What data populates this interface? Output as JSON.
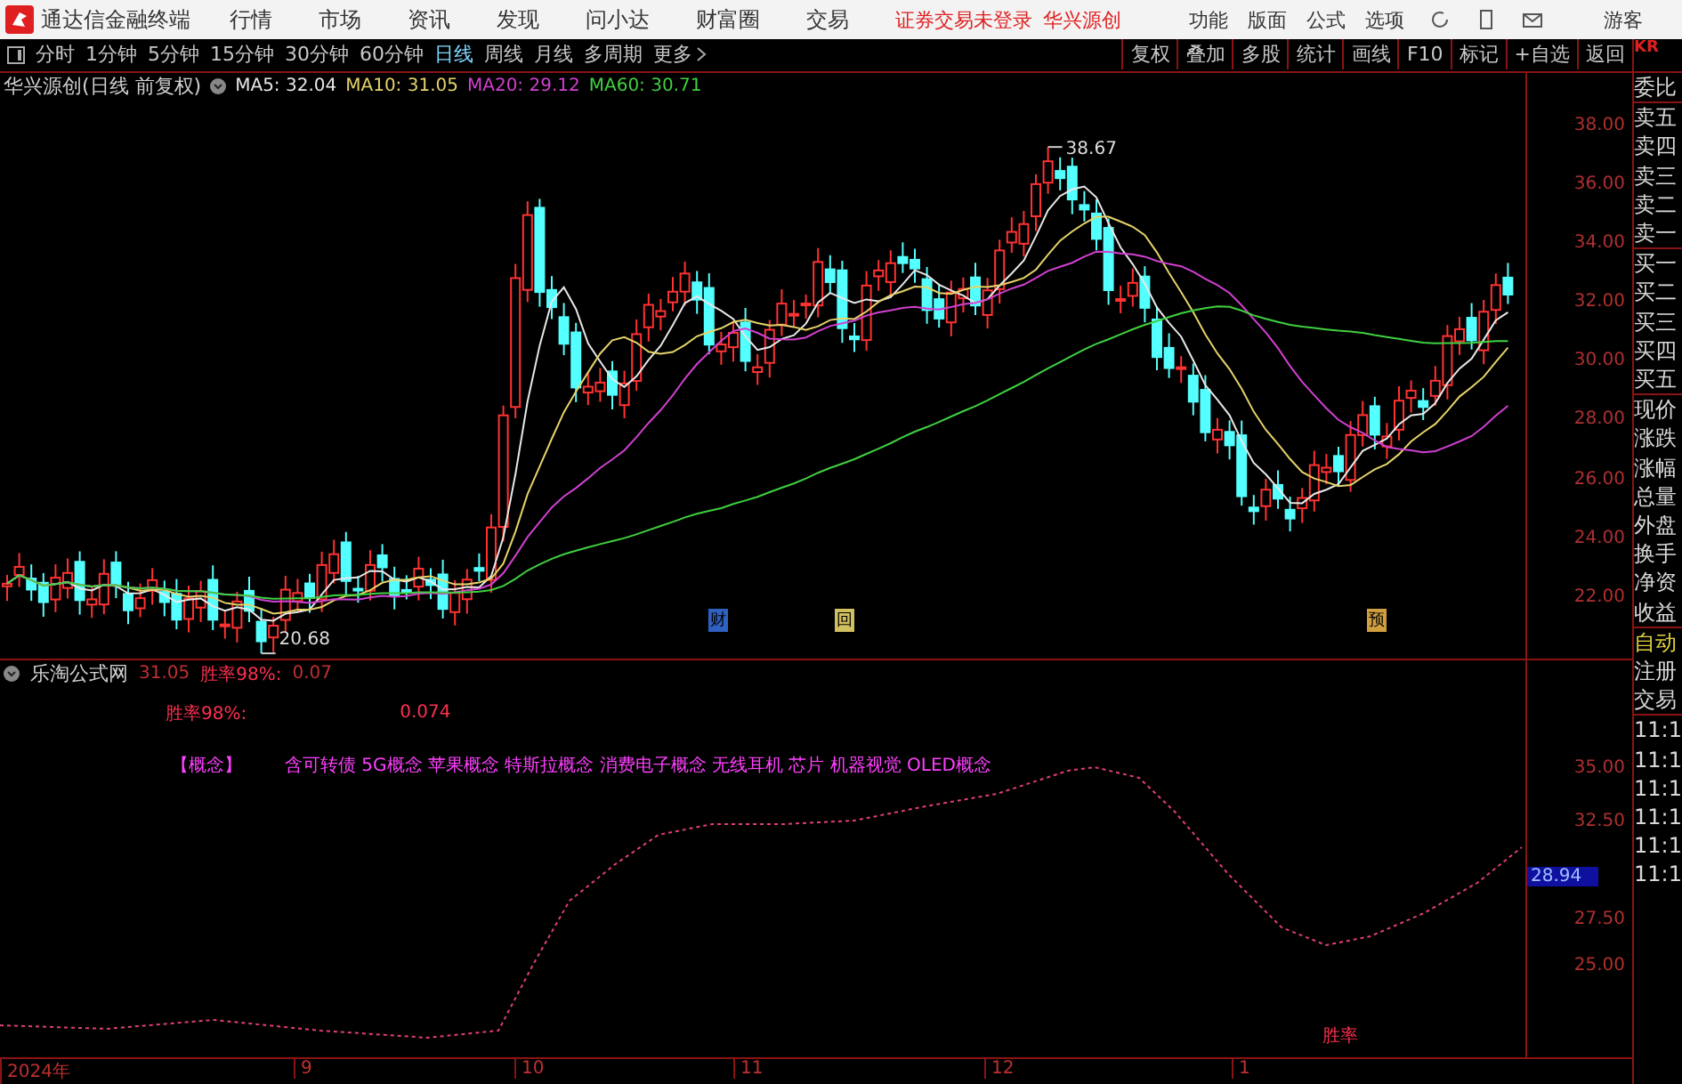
{
  "menubar": {
    "app_title": "通达信金融终端",
    "menus": [
      "行情",
      "市场",
      "资讯",
      "发现",
      "问小达",
      "财富圈",
      "交易"
    ],
    "login_status": "证券交易未登录",
    "stock": "华兴源创",
    "tools": [
      "功能",
      "版面",
      "公式",
      "选项"
    ],
    "user": "游客"
  },
  "toolbar": {
    "periods": [
      {
        "label": "分时",
        "selected": false
      },
      {
        "label": "1分钟",
        "selected": false
      },
      {
        "label": "5分钟",
        "selected": false
      },
      {
        "label": "15分钟",
        "selected": false
      },
      {
        "label": "30分钟",
        "selected": false
      },
      {
        "label": "60分钟",
        "selected": false
      },
      {
        "label": "日线",
        "selected": true
      },
      {
        "label": "周线",
        "selected": false
      },
      {
        "label": "月线",
        "selected": false
      },
      {
        "label": "多周期",
        "selected": false
      },
      {
        "label": "更多",
        "selected": false
      }
    ],
    "actions": [
      "复权",
      "叠加",
      "多股",
      "统计",
      "画线",
      "F10",
      "标记",
      "+自选",
      "返回"
    ]
  },
  "chart": {
    "title": "华兴源创(日线 前复权)",
    "ma": [
      {
        "label": "MA5: 32.04",
        "color": "#e8e8e8"
      },
      {
        "label": "MA10: 31.05",
        "color": "#e6d36a"
      },
      {
        "label": "MA20: 29.12",
        "color": "#d040d0"
      },
      {
        "label": "MA60: 30.71",
        "color": "#40d040"
      }
    ],
    "high_label": "38.67",
    "low_label": "20.68",
    "markers": [
      "财",
      "回",
      "预"
    ],
    "yticks": [
      "38.00",
      "36.00",
      "34.00",
      "32.00",
      "30.00",
      "28.00",
      "26.00",
      "24.00",
      "22.00"
    ]
  },
  "indicator": {
    "title": "乐淘公式网",
    "header_values": [
      "31.05",
      "胜率98%:",
      "0.07"
    ],
    "row_label": "胜率98%:",
    "row_value": "0.074",
    "concept_label": "【概念】",
    "concepts": "含可转债 5G概念 苹果概念 特斯拉概念 消费电子概念 无线耳机 芯片 机器视觉 OLED概念",
    "series_label": "胜率",
    "yticks": [
      "35.00",
      "32.50",
      "27.50",
      "25.00"
    ],
    "current_value": "28.94"
  },
  "dates": [
    "2024年",
    "9",
    "10",
    "11",
    "12",
    "1"
  ],
  "quote_panel": {
    "logo": "KR",
    "items": [
      {
        "label": "委比",
        "highlighted": false
      },
      {
        "label": "卖五",
        "highlighted": false
      },
      {
        "label": "卖四",
        "highlighted": false
      },
      {
        "label": "卖三",
        "highlighted": false
      },
      {
        "label": "卖二",
        "highlighted": false
      },
      {
        "label": "卖一",
        "highlighted": false
      },
      {
        "label": "买一",
        "highlighted": false
      },
      {
        "label": "买二",
        "highlighted": false
      },
      {
        "label": "买三",
        "highlighted": false
      },
      {
        "label": "买四",
        "highlighted": false
      },
      {
        "label": "买五",
        "highlighted": false
      },
      {
        "label": "现价",
        "highlighted": false
      },
      {
        "label": "涨跌",
        "highlighted": false
      },
      {
        "label": "涨幅",
        "highlighted": false
      },
      {
        "label": "总量",
        "highlighted": false
      },
      {
        "label": "外盘",
        "highlighted": false
      },
      {
        "label": "换手",
        "highlighted": false
      },
      {
        "label": "净资",
        "highlighted": false
      },
      {
        "label": "收益",
        "highlighted": false
      },
      {
        "label": "自动",
        "highlighted": true
      },
      {
        "label": "注册",
        "highlighted": false
      },
      {
        "label": "交易",
        "highlighted": false
      }
    ],
    "times": [
      "11:1",
      "11:1",
      "11:1",
      "11:1",
      "11:1",
      "11:1"
    ]
  }
}
